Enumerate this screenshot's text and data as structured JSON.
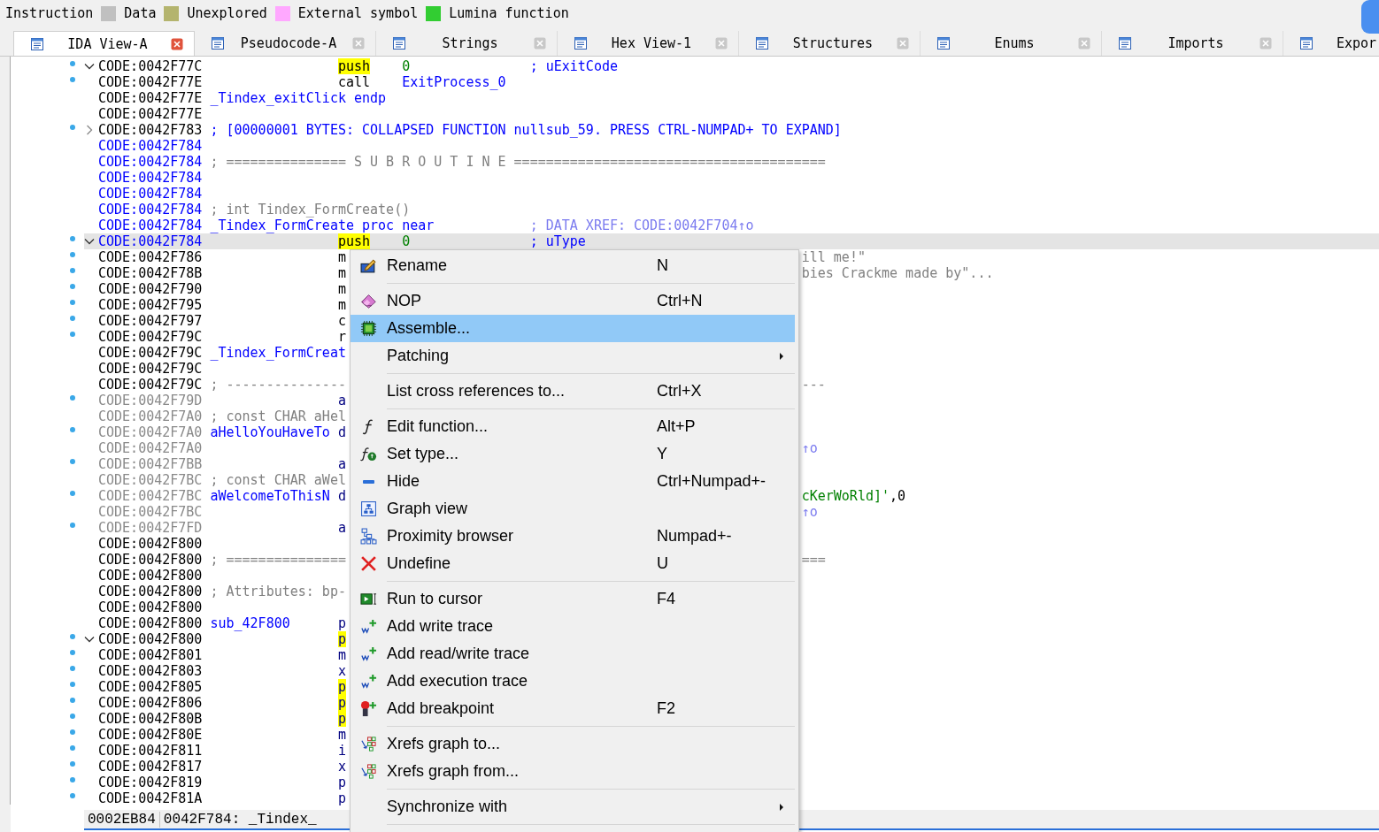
{
  "legend": [
    {
      "label": "Instruction"
    },
    {
      "label": "Data",
      "color": "#c0c0c0"
    },
    {
      "label": "Unexplored",
      "color": "#b4b46e"
    },
    {
      "label": "External symbol",
      "color": "#ffa8ff"
    },
    {
      "label": "Lumina function",
      "color": "#32cd32"
    }
  ],
  "tabs": [
    {
      "label": "IDA View-A",
      "selected": true,
      "closable": true
    },
    {
      "label": "Pseudocode-A",
      "selected": false,
      "closable": true
    },
    {
      "label": "Strings",
      "selected": false,
      "closable": true
    },
    {
      "label": "Hex View-1",
      "selected": false,
      "closable": true
    },
    {
      "label": "Structures",
      "selected": false,
      "closable": true
    },
    {
      "label": "Enums",
      "selected": false,
      "closable": true
    },
    {
      "label": "Imports",
      "selected": false,
      "closable": true
    },
    {
      "label": "Expor",
      "selected": false,
      "closable": false
    }
  ],
  "listing": [
    {
      "dot": true,
      "kind": "open",
      "selected": false,
      "addr": "CODE:0042F77C",
      "color": "#000000",
      "segs": [
        {
          "kind": "mnemonic",
          "text": "push",
          "highlight": true
        },
        {
          "kind": "number",
          "text": "0"
        },
        {
          "kind": "comment",
          "text": "; uExitCode"
        }
      ]
    },
    {
      "dot": true,
      "kind": "line",
      "selected": false,
      "addr": "CODE:0042F77E",
      "color": "#000000",
      "segs": [
        {
          "kind": "mnemonic",
          "text": "call",
          "highlight": false
        },
        {
          "kind": "operand",
          "text": "ExitProcess_0"
        }
      ]
    },
    {
      "dot": false,
      "kind": "line",
      "selected": false,
      "addr": "CODE:0042F77E",
      "color": "#000000",
      "segs": [
        {
          "kind": "label",
          "text": "_Tindex_exitClick endp"
        }
      ]
    },
    {
      "dot": false,
      "kind": "line",
      "selected": false,
      "addr": "CODE:0042F77E",
      "color": "#000000"
    },
    {
      "dot": true,
      "kind": "closed",
      "selected": false,
      "addr": "CODE:0042F783",
      "color": "#000000",
      "segs": [
        {
          "kind": "banner",
          "text": "; [00000001 BYTES: COLLAPSED FUNCTION nullsub_59. PRESS CTRL-NUMPAD+ TO EXPAND]"
        }
      ]
    },
    {
      "dot": false,
      "kind": "line",
      "selected": false,
      "addr": "CODE:0042F784",
      "color": "#0000ff"
    },
    {
      "dot": false,
      "kind": "line",
      "selected": false,
      "addr": "CODE:0042F784",
      "color": "#0000ff",
      "segs": [
        {
          "kind": "remark",
          "text": "; =============== S U B R O U T I N E ======================================="
        }
      ]
    },
    {
      "dot": false,
      "kind": "line",
      "selected": false,
      "addr": "CODE:0042F784",
      "color": "#0000ff"
    },
    {
      "dot": false,
      "kind": "line",
      "selected": false,
      "addr": "CODE:0042F784",
      "color": "#0000ff"
    },
    {
      "dot": false,
      "kind": "line",
      "selected": false,
      "addr": "CODE:0042F784",
      "color": "#0000ff",
      "segs": [
        {
          "kind": "remark",
          "text": "; int Tindex_FormCreate()"
        }
      ]
    },
    {
      "dot": false,
      "kind": "line",
      "selected": false,
      "addr": "CODE:0042F784",
      "color": "#0000ff",
      "segs": [
        {
          "kind": "label",
          "text": "_Tindex_FormCreate proc near"
        },
        {
          "kind": "xref",
          "text": "; DATA XREF: CODE:0042F704↑o"
        }
      ]
    },
    {
      "dot": true,
      "kind": "open",
      "selected": true,
      "addr": "CODE:0042F784",
      "color": "#0000ff",
      "segs": [
        {
          "kind": "mnemonic",
          "text": "push",
          "highlight": true
        },
        {
          "kind": "number",
          "text": "0"
        },
        {
          "kind": "comment",
          "text": "; uType"
        }
      ]
    },
    {
      "dot": true,
      "kind": "line",
      "selected": false,
      "addr": "CODE:0042F786",
      "color": "#000000",
      "segs": [
        {
          "kind": "mnemonic",
          "text": "m",
          "highlight": false
        },
        {
          "kind": "tailremark",
          "text": "ill me!\""
        }
      ]
    },
    {
      "dot": true,
      "kind": "line",
      "selected": false,
      "addr": "CODE:0042F78B",
      "color": "#000000",
      "segs": [
        {
          "kind": "mnemonic",
          "text": "m",
          "highlight": false
        },
        {
          "kind": "tailremark",
          "text": "bies Crackme made by\"..."
        }
      ]
    },
    {
      "dot": true,
      "kind": "line",
      "selected": false,
      "addr": "CODE:0042F790",
      "color": "#000000",
      "segs": [
        {
          "kind": "mnemonic",
          "text": "m",
          "highlight": false
        }
      ]
    },
    {
      "dot": true,
      "kind": "line",
      "selected": false,
      "addr": "CODE:0042F795",
      "color": "#000000",
      "segs": [
        {
          "kind": "mnemonic",
          "text": "m",
          "highlight": false
        }
      ]
    },
    {
      "dot": true,
      "kind": "line",
      "selected": false,
      "addr": "CODE:0042F797",
      "color": "#000000",
      "segs": [
        {
          "kind": "mnemonic",
          "text": "c",
          "highlight": false
        }
      ]
    },
    {
      "dot": true,
      "kind": "line",
      "selected": false,
      "addr": "CODE:0042F79C",
      "color": "#000000",
      "segs": [
        {
          "kind": "mnemonic",
          "text": "r",
          "highlight": false
        }
      ]
    },
    {
      "dot": false,
      "kind": "line",
      "selected": false,
      "addr": "CODE:0042F79C",
      "color": "#000000",
      "segs": [
        {
          "kind": "label",
          "text": "_Tindex_FormCreat"
        }
      ]
    },
    {
      "dot": false,
      "kind": "line",
      "selected": false,
      "addr": "CODE:0042F79C",
      "color": "#000000"
    },
    {
      "dot": false,
      "kind": "line",
      "selected": false,
      "addr": "CODE:0042F79C",
      "color": "#000000",
      "segs": [
        {
          "kind": "remark",
          "text": "; ---------------"
        },
        {
          "kind": "tailremark",
          "text": "---"
        }
      ]
    },
    {
      "dot": true,
      "kind": "line",
      "selected": false,
      "addr": "CODE:0042F79D",
      "color": "#8a8a8a",
      "segs": [
        {
          "kind": "directive",
          "text": "a",
          "highlight": false
        }
      ]
    },
    {
      "dot": false,
      "kind": "line",
      "selected": false,
      "addr": "CODE:0042F7A0",
      "color": "#8a8a8a",
      "segs": [
        {
          "kind": "remark",
          "text": "; const CHAR aHel"
        }
      ]
    },
    {
      "dot": true,
      "kind": "line",
      "selected": false,
      "addr": "CODE:0042F7A0",
      "color": "#8a8a8a",
      "segs": [
        {
          "kind": "label",
          "text": "aHelloYouHaveTo"
        },
        {
          "kind": "directive",
          "text": "d",
          "highlight": false
        }
      ]
    },
    {
      "dot": false,
      "kind": "line",
      "selected": false,
      "addr": "CODE:0042F7A0",
      "color": "#8a8a8a",
      "segs": [
        {
          "kind": "tailxref",
          "text": "↑o"
        }
      ]
    },
    {
      "dot": true,
      "kind": "line",
      "selected": false,
      "addr": "CODE:0042F7BB",
      "color": "#8a8a8a",
      "segs": [
        {
          "kind": "directive",
          "text": "a",
          "highlight": false
        }
      ]
    },
    {
      "dot": false,
      "kind": "line",
      "selected": false,
      "addr": "CODE:0042F7BC",
      "color": "#8a8a8a",
      "segs": [
        {
          "kind": "remark",
          "text": "; const CHAR aWel"
        }
      ]
    },
    {
      "dot": true,
      "kind": "line",
      "selected": false,
      "addr": "CODE:0042F7BC",
      "color": "#8a8a8a",
      "segs": [
        {
          "kind": "label",
          "text": "aWelcomeToThisN"
        },
        {
          "kind": "directive",
          "text": "d",
          "highlight": false
        },
        {
          "kind": "tailstring",
          "text": "cKerWoRld]'"
        },
        {
          "kind": "punct",
          "text": ",0"
        }
      ]
    },
    {
      "dot": false,
      "kind": "line",
      "selected": false,
      "addr": "CODE:0042F7BC",
      "color": "#8a8a8a",
      "segs": [
        {
          "kind": "tailxref",
          "text": "↑o"
        }
      ]
    },
    {
      "dot": true,
      "kind": "line",
      "selected": false,
      "addr": "CODE:0042F7FD",
      "color": "#8a8a8a",
      "segs": [
        {
          "kind": "directive",
          "text": "a",
          "highlight": false
        }
      ]
    },
    {
      "dot": false,
      "kind": "line",
      "selected": false,
      "addr": "CODE:0042F800",
      "color": "#000000"
    },
    {
      "dot": false,
      "kind": "line",
      "selected": false,
      "addr": "CODE:0042F800",
      "color": "#000000",
      "segs": [
        {
          "kind": "remark",
          "text": "; ==============="
        },
        {
          "kind": "tailremark",
          "text": "==="
        }
      ]
    },
    {
      "dot": false,
      "kind": "line",
      "selected": false,
      "addr": "CODE:0042F800",
      "color": "#000000"
    },
    {
      "dot": false,
      "kind": "line",
      "selected": false,
      "addr": "CODE:0042F800",
      "color": "#000000",
      "segs": [
        {
          "kind": "remark",
          "text": "; Attributes: bp-"
        }
      ]
    },
    {
      "dot": false,
      "kind": "line",
      "selected": false,
      "addr": "CODE:0042F800",
      "color": "#000000"
    },
    {
      "dot": false,
      "kind": "line",
      "selected": false,
      "addr": "CODE:0042F800",
      "color": "#000000",
      "segs": [
        {
          "kind": "label",
          "text": "sub_42F800"
        },
        {
          "kind": "directive",
          "text": "p",
          "highlight": false
        }
      ]
    },
    {
      "dot": true,
      "kind": "open",
      "selected": false,
      "addr": "CODE:0042F800",
      "color": "#000000",
      "segs": [
        {
          "kind": "directive",
          "text": "p",
          "highlight": true
        }
      ]
    },
    {
      "dot": true,
      "kind": "line",
      "selected": false,
      "addr": "CODE:0042F801",
      "color": "#000000",
      "segs": [
        {
          "kind": "directive",
          "text": "m",
          "highlight": false
        }
      ]
    },
    {
      "dot": true,
      "kind": "line",
      "selected": false,
      "addr": "CODE:0042F803",
      "color": "#000000",
      "segs": [
        {
          "kind": "directive",
          "text": "x",
          "highlight": false
        }
      ]
    },
    {
      "dot": true,
      "kind": "line",
      "selected": false,
      "addr": "CODE:0042F805",
      "color": "#000000",
      "segs": [
        {
          "kind": "directive",
          "text": "p",
          "highlight": true
        }
      ]
    },
    {
      "dot": true,
      "kind": "line",
      "selected": false,
      "addr": "CODE:0042F806",
      "color": "#000000",
      "segs": [
        {
          "kind": "directive",
          "text": "p",
          "highlight": true
        }
      ]
    },
    {
      "dot": true,
      "kind": "line",
      "selected": false,
      "addr": "CODE:0042F80B",
      "color": "#000000",
      "segs": [
        {
          "kind": "directive",
          "text": "p",
          "highlight": true
        }
      ]
    },
    {
      "dot": true,
      "kind": "line",
      "selected": false,
      "addr": "CODE:0042F80E",
      "color": "#000000",
      "segs": [
        {
          "kind": "directive",
          "text": "m",
          "highlight": false
        }
      ]
    },
    {
      "dot": true,
      "kind": "line",
      "selected": false,
      "addr": "CODE:0042F811",
      "color": "#000000",
      "segs": [
        {
          "kind": "directive",
          "text": "i",
          "highlight": false
        }
      ]
    },
    {
      "dot": true,
      "kind": "line",
      "selected": false,
      "addr": "CODE:0042F817",
      "color": "#000000",
      "segs": [
        {
          "kind": "directive",
          "text": "x",
          "highlight": false
        }
      ]
    },
    {
      "dot": true,
      "kind": "line",
      "selected": false,
      "addr": "CODE:0042F819",
      "color": "#000000",
      "segs": [
        {
          "kind": "directive",
          "text": "p",
          "highlight": false
        }
      ]
    },
    {
      "dot": true,
      "kind": "line",
      "selected": false,
      "addr": "CODE:0042F81A",
      "color": "#000000",
      "segs": [
        {
          "kind": "directive",
          "text": "p",
          "highlight": false
        }
      ]
    }
  ],
  "status_bar": {
    "offset": "0002EB84",
    "location": "0042F784: _Tindex_"
  },
  "context_menu": [
    {
      "kind": "item",
      "label": "Rename",
      "shortcut": "N",
      "selected": false,
      "submenu": false
    },
    {
      "kind": "separator"
    },
    {
      "kind": "item",
      "label": "NOP",
      "shortcut": "Ctrl+N",
      "selected": false,
      "submenu": false
    },
    {
      "kind": "item",
      "label": "Assemble...",
      "selected": true,
      "submenu": false
    },
    {
      "kind": "item",
      "label": "Patching",
      "selected": false,
      "submenu": true
    },
    {
      "kind": "separator"
    },
    {
      "kind": "item",
      "label": "List cross references to...",
      "shortcut": "Ctrl+X",
      "selected": false,
      "submenu": false
    },
    {
      "kind": "separator"
    },
    {
      "kind": "item",
      "label": "Edit function...",
      "shortcut": "Alt+P",
      "selected": false,
      "submenu": false
    },
    {
      "kind": "item",
      "label": "Set type...",
      "shortcut": "Y",
      "selected": false,
      "submenu": false
    },
    {
      "kind": "item",
      "label": "Hide",
      "shortcut": "Ctrl+Numpad+-",
      "selected": false,
      "submenu": false
    },
    {
      "kind": "item",
      "label": "Graph view",
      "selected": false,
      "submenu": false
    },
    {
      "kind": "item",
      "label": "Proximity browser",
      "shortcut": "Numpad+-",
      "selected": false,
      "submenu": false
    },
    {
      "kind": "item",
      "label": "Undefine",
      "shortcut": "U",
      "selected": false,
      "submenu": false
    },
    {
      "kind": "separator"
    },
    {
      "kind": "item",
      "label": "Run to cursor",
      "shortcut": "F4",
      "selected": false,
      "submenu": false
    },
    {
      "kind": "item",
      "label": "Add write trace",
      "selected": false,
      "submenu": false
    },
    {
      "kind": "item",
      "label": "Add read/write trace",
      "selected": false,
      "submenu": false
    },
    {
      "kind": "item",
      "label": "Add execution trace",
      "selected": false,
      "submenu": false
    },
    {
      "kind": "item",
      "label": "Add breakpoint",
      "shortcut": "F2",
      "selected": false,
      "submenu": false
    },
    {
      "kind": "separator"
    },
    {
      "kind": "item",
      "label": "Xrefs graph to...",
      "selected": false,
      "submenu": false
    },
    {
      "kind": "item",
      "label": "Xrefs graph from...",
      "selected": false,
      "submenu": false
    },
    {
      "kind": "separator"
    },
    {
      "kind": "item",
      "label": "Synchronize with",
      "selected": false,
      "submenu": true
    },
    {
      "kind": "separator"
    }
  ]
}
